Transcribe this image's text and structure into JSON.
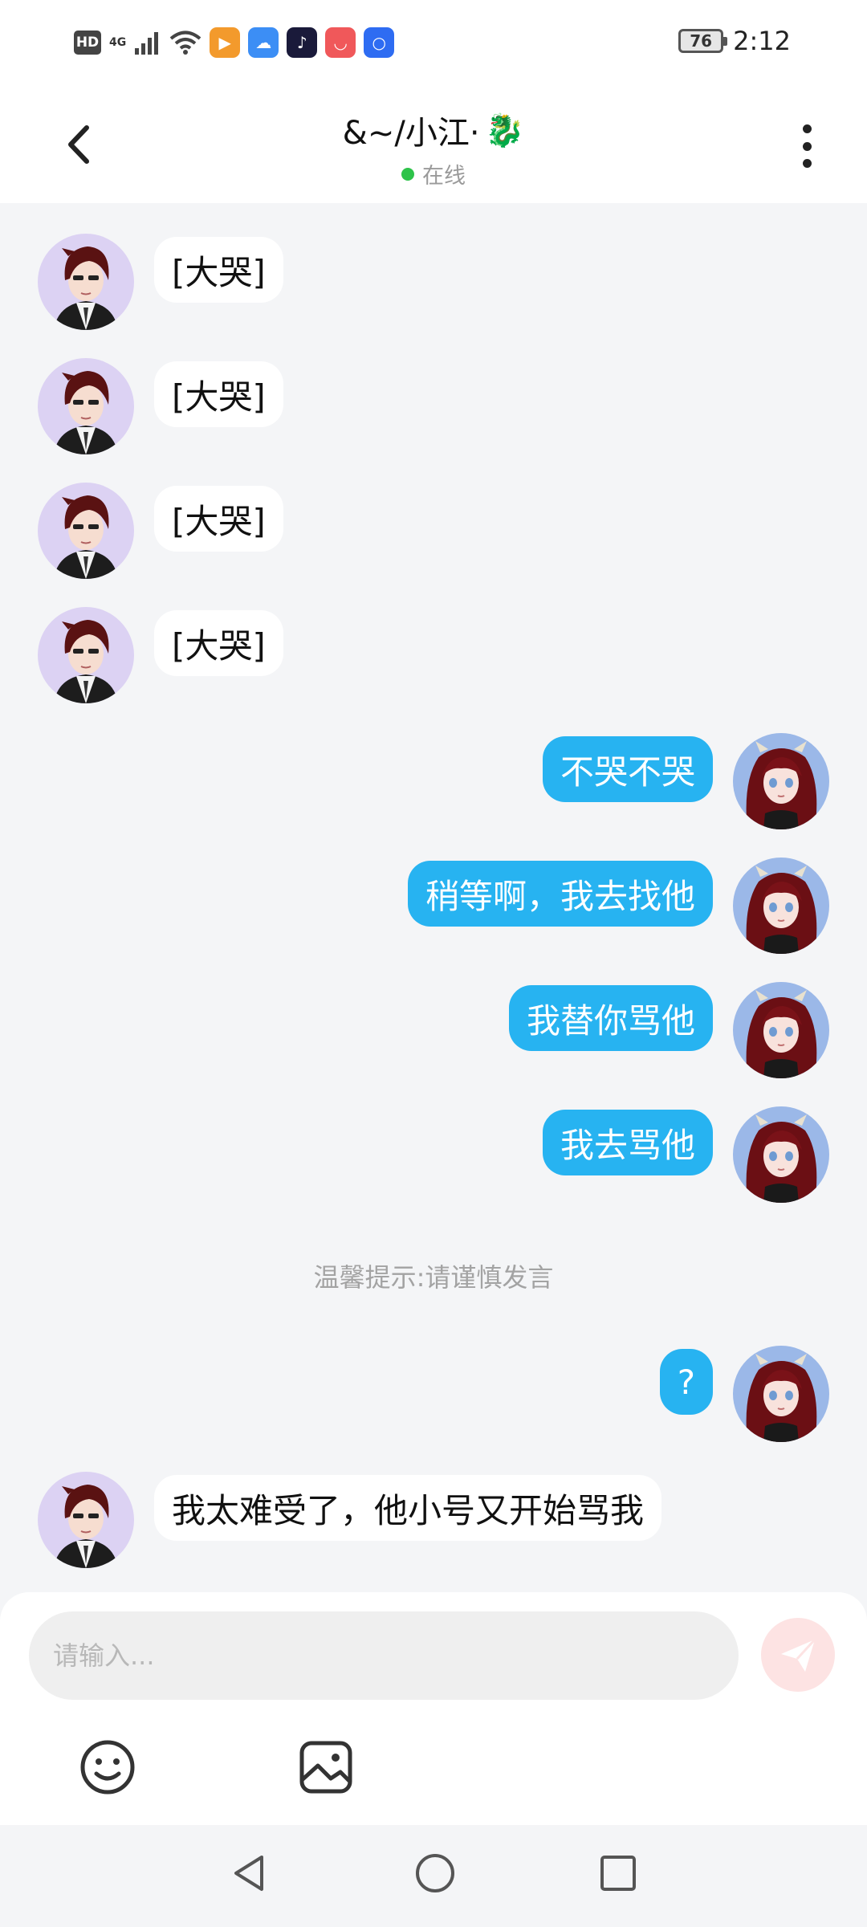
{
  "status_bar": {
    "hd": "HD",
    "network": "4G",
    "battery": "76",
    "time": "2:12",
    "icons": [
      "signal-icon",
      "wifi-icon",
      "video-app-icon",
      "cloud-app-icon",
      "tiktok-app-icon",
      "shop-app-icon",
      "bulb-app-icon"
    ]
  },
  "header": {
    "title": "&~/小江·",
    "title_emoji": "🐉",
    "status": "在线",
    "status_color": "#2ec34a"
  },
  "messages": [
    {
      "side": "in",
      "text": "[大哭]"
    },
    {
      "side": "in",
      "text": "[大哭]"
    },
    {
      "side": "in",
      "text": "[大哭]"
    },
    {
      "side": "in",
      "text": "[大哭]"
    },
    {
      "side": "out",
      "text": "不哭不哭"
    },
    {
      "side": "out",
      "text": "稍等啊，我去找他"
    },
    {
      "side": "out",
      "text": "我替你骂他"
    },
    {
      "side": "out",
      "text": "我去骂他"
    },
    {
      "side": "notice",
      "text": "温馨提示:请谨慎发言"
    },
    {
      "side": "out",
      "text": "?"
    },
    {
      "side": "in",
      "text": "我太难受了，他小号又开始骂我"
    }
  ],
  "input": {
    "placeholder": "请输入...",
    "value": ""
  },
  "colors": {
    "outgoing_bubble": "#27b3f1",
    "incoming_bubble": "#ffffff",
    "send_button": "#fde3e3",
    "background": "#f4f5f7"
  }
}
